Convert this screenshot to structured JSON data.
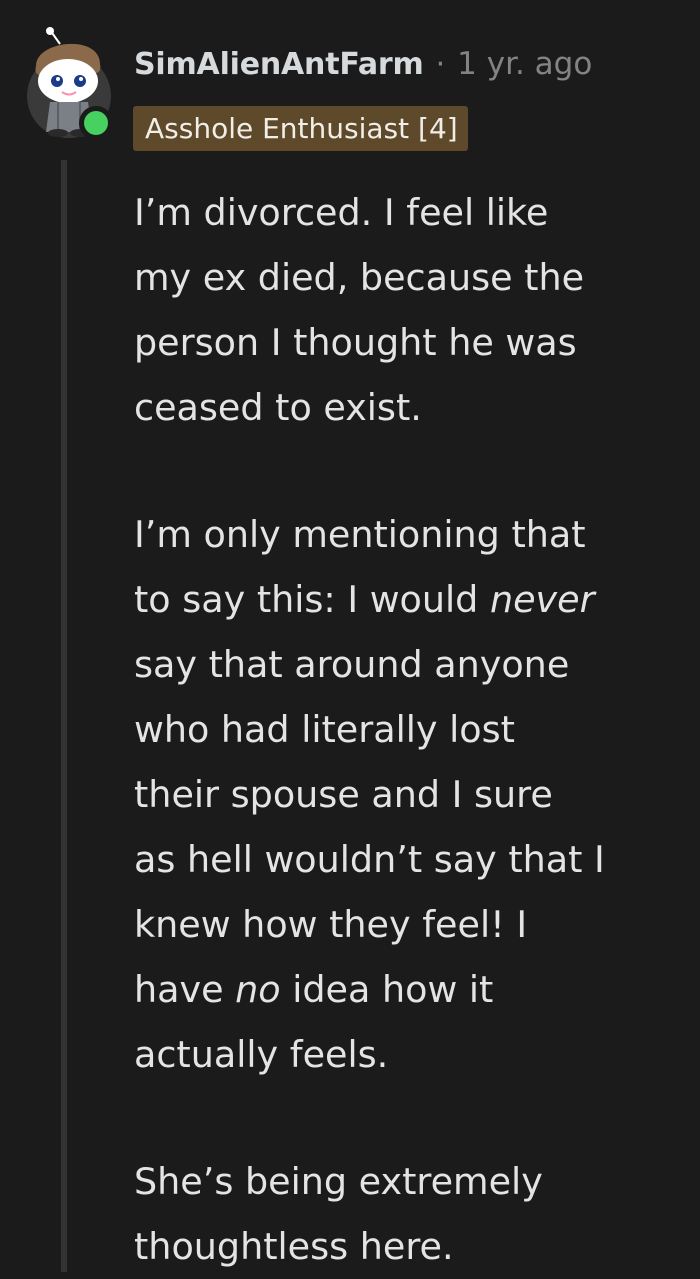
{
  "comment": {
    "username": "SimAlienAntFarm",
    "separator": "·",
    "timestamp": "1 yr. ago",
    "flair": "Asshole Enthusiast [4]",
    "avatar_icon": "snoo-avatar-icon",
    "online_color": "#46d160",
    "paragraphs": [
      {
        "lines": [
          {
            "parts": [
              "I’m divorced. I feel like"
            ]
          },
          {
            "parts": [
              "my ex died, because the"
            ]
          },
          {
            "parts": [
              "person I thought he was"
            ]
          },
          {
            "parts": [
              "ceased to exist."
            ]
          }
        ]
      },
      {
        "lines": [
          {
            "parts": [
              "I’m only mentioning that"
            ]
          },
          {
            "parts": [
              "to say this: I would ",
              "never",
              ""
            ]
          },
          {
            "parts": [
              "say that around anyone"
            ]
          },
          {
            "parts": [
              "who had literally lost"
            ]
          },
          {
            "parts": [
              "their spouse and I sure"
            ]
          },
          {
            "parts": [
              "as hell wouldn’t say that I"
            ]
          },
          {
            "parts": [
              "knew how they feel! I"
            ]
          },
          {
            "parts": [
              "have ",
              "no",
              " idea how it"
            ]
          },
          {
            "parts": [
              "actually feels."
            ]
          }
        ]
      },
      {
        "lines": [
          {
            "parts": [
              "She’s being extremely"
            ]
          },
          {
            "parts": [
              "thoughtless here."
            ]
          }
        ]
      }
    ]
  }
}
